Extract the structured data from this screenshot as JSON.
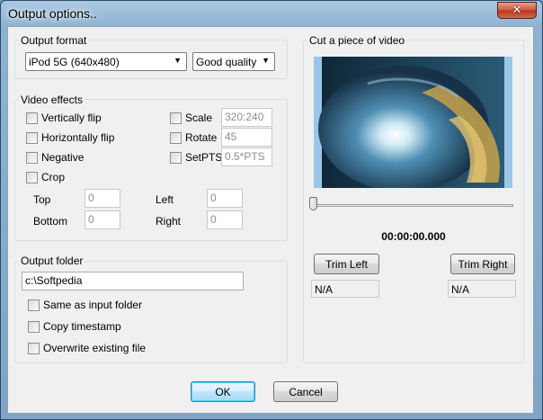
{
  "window": {
    "title": "Output options..",
    "close_glyph": "✕"
  },
  "output_format": {
    "legend": "Output format",
    "format_selected": "iPod 5G (640x480)",
    "quality_selected": "Good quality"
  },
  "video_effects": {
    "legend": "Video effects",
    "vertical_flip": {
      "label": "Vertically flip",
      "checked": false
    },
    "horizontal_flip": {
      "label": "Horizontally flip",
      "checked": false
    },
    "negative": {
      "label": "Negative",
      "checked": false
    },
    "crop": {
      "label": "Crop",
      "checked": false
    },
    "scale": {
      "label": "Scale",
      "value": "320:240",
      "checked": false
    },
    "rotate": {
      "label": "Rotate",
      "value": "45",
      "checked": false
    },
    "setpts": {
      "label": "SetPTS",
      "value": "0.5*PTS",
      "checked": false
    },
    "crop_fields": {
      "top": {
        "label": "Top",
        "value": "0"
      },
      "bottom": {
        "label": "Bottom",
        "value": "0"
      },
      "left": {
        "label": "Left",
        "value": "0"
      },
      "right": {
        "label": "Right",
        "value": "0"
      }
    }
  },
  "output_folder": {
    "legend": "Output folder",
    "path": "c:\\Softpedia",
    "same_as_input": {
      "label": "Same as input folder",
      "checked": false
    },
    "copy_timestamp": {
      "label": "Copy timestamp",
      "checked": false
    },
    "overwrite": {
      "label": "Overwrite existing file",
      "checked": false
    }
  },
  "cut_video": {
    "legend": "Cut a piece of video",
    "timecode": "00:00:00.000",
    "position": 0,
    "trim_left_label": "Trim Left",
    "trim_right_label": "Trim Right",
    "trim_left_value": "N/A",
    "trim_right_value": "N/A"
  },
  "buttons": {
    "ok": "OK",
    "cancel": "Cancel"
  },
  "icons": {
    "combo_arrow": "▼"
  },
  "colors": {
    "accent": "#3c7fb1",
    "titlebar": "#a9c8e2",
    "close": "#c94a2e"
  }
}
